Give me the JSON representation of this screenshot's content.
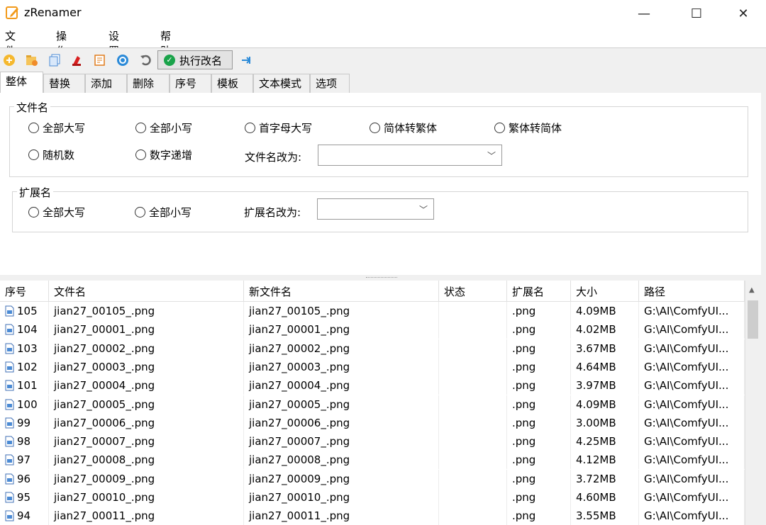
{
  "window": {
    "title": "zRenamer",
    "minimize": "—",
    "maximize": "☐",
    "close": "✕"
  },
  "menu": [
    "文件(F)",
    "操作(P)",
    "设置(S)",
    "帮助(H)"
  ],
  "toolbar": {
    "execute_label": "执行改名",
    "accent": "#1aa34a"
  },
  "tabs": [
    "整体",
    "替换",
    "添加",
    "删除",
    "序号",
    "模板",
    "文本模式",
    "选项"
  ],
  "filename_group": {
    "label": "文件名",
    "options_row1": [
      "全部大写",
      "全部小写",
      "首字母大写",
      "简体转繁体",
      "繁体转简体"
    ],
    "options_row2": [
      "随机数",
      "数字递增"
    ],
    "rename_label": "文件名改为:",
    "rename_value": ""
  },
  "ext_group": {
    "label": "扩展名",
    "options": [
      "全部大写",
      "全部小写"
    ],
    "rename_label": "扩展名改为:",
    "rename_value": ""
  },
  "table": {
    "columns": [
      "序号",
      "文件名",
      "新文件名",
      "状态",
      "扩展名",
      "大小",
      "路径"
    ],
    "rows": [
      [
        "105",
        "jian27_00105_.png",
        "jian27_00105_.png",
        "",
        ".png",
        "4.09MB",
        "G:\\AI\\ComfyUI..."
      ],
      [
        "104",
        "jian27_00001_.png",
        "jian27_00001_.png",
        "",
        ".png",
        "4.02MB",
        "G:\\AI\\ComfyUI..."
      ],
      [
        "103",
        "jian27_00002_.png",
        "jian27_00002_.png",
        "",
        ".png",
        "3.67MB",
        "G:\\AI\\ComfyUI..."
      ],
      [
        "102",
        "jian27_00003_.png",
        "jian27_00003_.png",
        "",
        ".png",
        "4.64MB",
        "G:\\AI\\ComfyUI..."
      ],
      [
        "101",
        "jian27_00004_.png",
        "jian27_00004_.png",
        "",
        ".png",
        "3.97MB",
        "G:\\AI\\ComfyUI..."
      ],
      [
        "100",
        "jian27_00005_.png",
        "jian27_00005_.png",
        "",
        ".png",
        "4.09MB",
        "G:\\AI\\ComfyUI..."
      ],
      [
        "99",
        "jian27_00006_.png",
        "jian27_00006_.png",
        "",
        ".png",
        "3.00MB",
        "G:\\AI\\ComfyUI..."
      ],
      [
        "98",
        "jian27_00007_.png",
        "jian27_00007_.png",
        "",
        ".png",
        "4.25MB",
        "G:\\AI\\ComfyUI..."
      ],
      [
        "97",
        "jian27_00008_.png",
        "jian27_00008_.png",
        "",
        ".png",
        "4.12MB",
        "G:\\AI\\ComfyUI..."
      ],
      [
        "96",
        "jian27_00009_.png",
        "jian27_00009_.png",
        "",
        ".png",
        "3.72MB",
        "G:\\AI\\ComfyUI..."
      ],
      [
        "95",
        "jian27_00010_.png",
        "jian27_00010_.png",
        "",
        ".png",
        "4.60MB",
        "G:\\AI\\ComfyUI..."
      ],
      [
        "94",
        "jian27_00011_.png",
        "jian27_00011_.png",
        "",
        ".png",
        "3.55MB",
        "G:\\AI\\ComfyUI..."
      ]
    ]
  }
}
